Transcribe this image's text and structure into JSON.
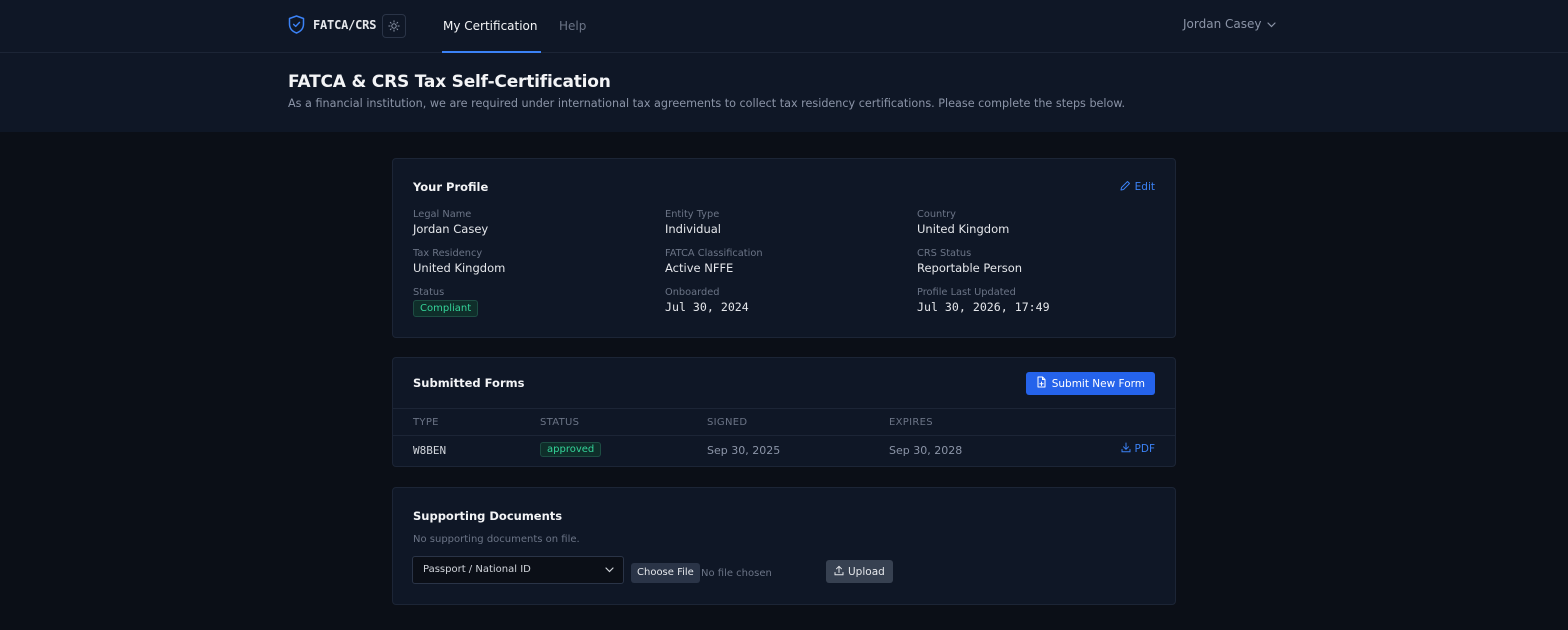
{
  "app": {
    "name": "FATCA/CRS"
  },
  "nav": {
    "tabs": [
      {
        "label": "My Certification",
        "active": true
      },
      {
        "label": "Help",
        "active": false
      }
    ],
    "user": "Jordan Casey"
  },
  "page": {
    "title": "FATCA & CRS Tax Self-Certification",
    "subtitle": "As a financial institution, we are required under international tax agreements to collect tax residency certifications. Please complete the steps below."
  },
  "profile": {
    "title": "Your Profile",
    "edit_label": "Edit",
    "fields": {
      "legal_name": {
        "label": "Legal Name",
        "value": "Jordan Casey"
      },
      "entity_type": {
        "label": "Entity Type",
        "value": "Individual"
      },
      "country": {
        "label": "Country",
        "value": "United Kingdom"
      },
      "tax_residency": {
        "label": "Tax Residency",
        "value": "United Kingdom"
      },
      "fatca_classification": {
        "label": "FATCA Classification",
        "value": "Active NFFE"
      },
      "crs_status": {
        "label": "CRS Status",
        "value": "Reportable Person"
      },
      "status": {
        "label": "Status",
        "value": "Compliant"
      },
      "onboarded": {
        "label": "Onboarded",
        "value": "Jul 30, 2024"
      },
      "last_updated": {
        "label": "Profile Last Updated",
        "value": "Jul 30, 2026, 17:49"
      }
    }
  },
  "forms": {
    "title": "Submitted Forms",
    "submit_label": "Submit New Form",
    "columns": [
      "TYPE",
      "STATUS",
      "SIGNED",
      "EXPIRES"
    ],
    "rows": [
      {
        "type": "W8BEN",
        "status": "approved",
        "signed": "Sep 30, 2025",
        "expires": "Sep 30, 2028",
        "action": "PDF"
      }
    ]
  },
  "documents": {
    "title": "Supporting Documents",
    "empty_text": "No supporting documents on file.",
    "doc_type_selected": "Passport / National ID",
    "choose_file_label": "Choose File",
    "no_file_text": "No file chosen",
    "upload_label": "Upload"
  },
  "colors": {
    "accent": "#3b82f6",
    "primary_button": "#2563eb",
    "success": "#34d399",
    "background": "#0b0f17",
    "surface": "#0f1726"
  },
  "icons": {
    "brand": "shield-check-icon",
    "theme": "sun-icon",
    "user_menu": "chevron-down-icon",
    "edit": "pencil-icon",
    "submit": "file-plus-icon",
    "pdf": "download-icon",
    "select": "chevron-down-icon",
    "upload": "upload-icon"
  }
}
